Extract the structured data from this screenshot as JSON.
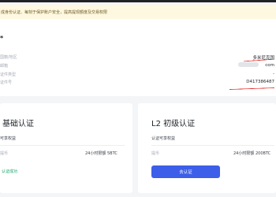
{
  "notice": {
    "text": "成身份认证、每刻于保护账户安全，提高提现额度及交易权限"
  },
  "identity": {
    "marker": "*",
    "rows": [
      {
        "label": "国籍/地区",
        "value": "多米尼克国"
      },
      {
        "label": "邮箱",
        "value": "com"
      },
      {
        "label": "证件类型",
        "value": "-"
      },
      {
        "label": "证件号",
        "value": "D417386487"
      }
    ]
  },
  "basic": {
    "title": "基础认证",
    "subtitle": "可享权益",
    "row_label": "提币",
    "row_value": "24小时限额 5BTC",
    "status": "认证成功"
  },
  "l2": {
    "title": "L2 初级认证",
    "subtitle": "认证可享权益",
    "row_label": "提币",
    "row_value": "24小时限额 200BTC",
    "button": "去认证"
  },
  "colors": {
    "accent": "#3c5ee8",
    "success": "#1ca36a",
    "annotation": "#e0201a"
  }
}
